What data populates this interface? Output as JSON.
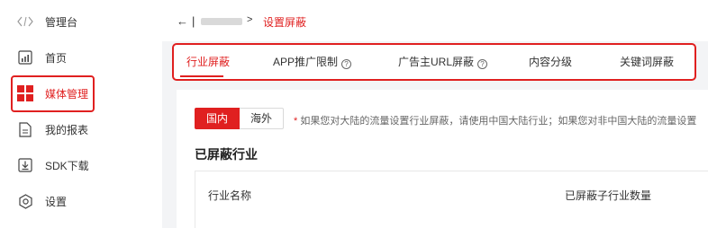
{
  "sidebar": {
    "items": [
      {
        "icon": "code-icon",
        "label": "管理台"
      },
      {
        "icon": "chart-icon",
        "label": "首页"
      },
      {
        "icon": "grid-icon",
        "label": "媒体管理"
      },
      {
        "icon": "document-icon",
        "label": "我的报表"
      },
      {
        "icon": "download-icon",
        "label": "SDK下载"
      },
      {
        "icon": "settings-icon",
        "label": "设置"
      }
    ]
  },
  "header": {
    "back": "←",
    "separator": "|",
    "crumb_arrow": ">",
    "current": "设置屏蔽"
  },
  "tabs": [
    {
      "label": "行业屏蔽",
      "help": false
    },
    {
      "label": "APP推广限制",
      "help": true
    },
    {
      "label": "广告主URL屏蔽",
      "help": true
    },
    {
      "label": "内容分级",
      "help": false
    },
    {
      "label": "关键词屏蔽",
      "help": false
    }
  ],
  "region": {
    "domestic": "国内",
    "overseas": "海外"
  },
  "notice": {
    "star": "*",
    "text": "如果您对大陆的流量设置行业屏蔽，请使用中国大陆行业；如果您对非中国大陆的流量设置"
  },
  "section_title": "已屏蔽行业",
  "table": {
    "columns": [
      "行业名称",
      "已屏蔽子行业数量"
    ]
  },
  "colors": {
    "accent": "#e02020",
    "background": "#f3f4f6"
  }
}
